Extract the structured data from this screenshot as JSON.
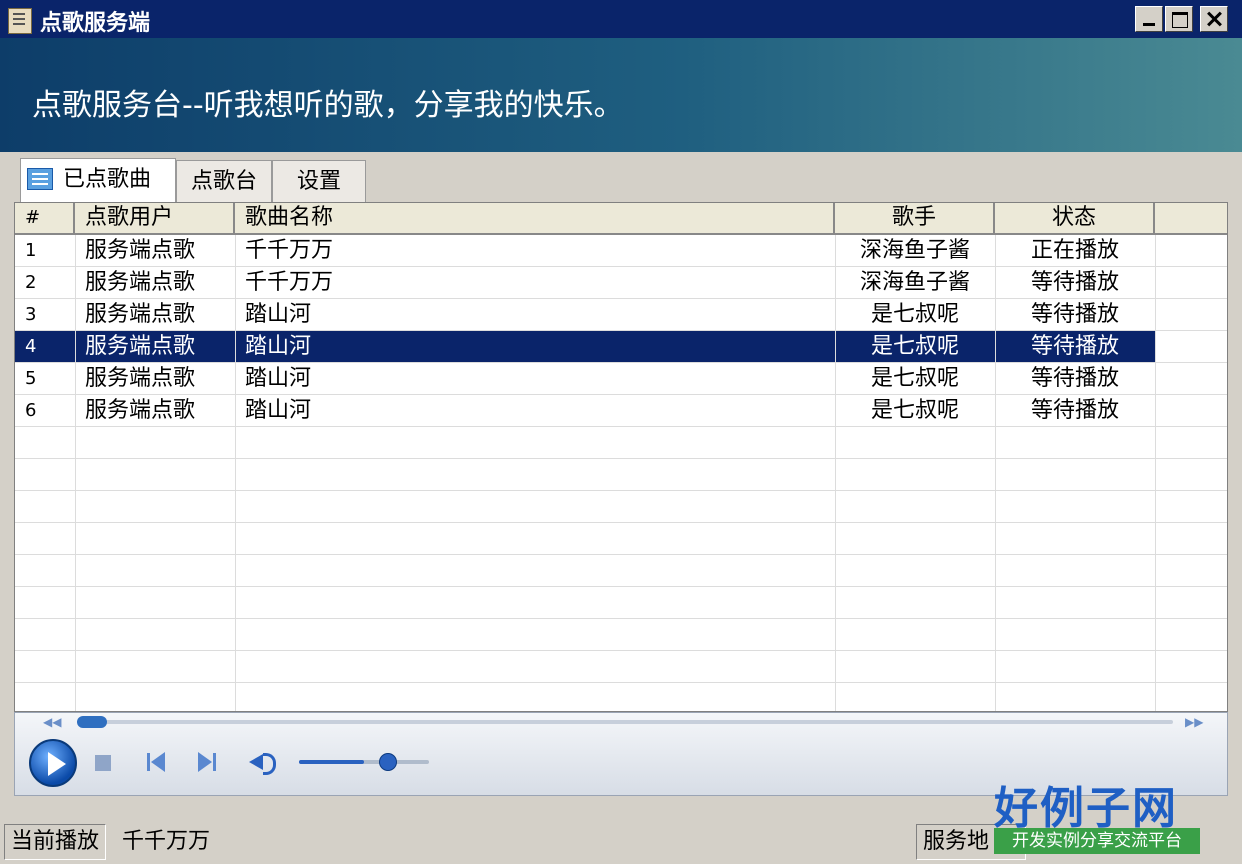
{
  "window": {
    "title": "点歌服务端"
  },
  "banner": {
    "text": "点歌服务台--听我想听的歌，分享我的快乐。"
  },
  "tabs": [
    {
      "label": "已点歌曲",
      "active": true
    },
    {
      "label": "点歌台",
      "active": false
    },
    {
      "label": "设置",
      "active": false
    }
  ],
  "table": {
    "columns": [
      "#",
      "点歌用户",
      "歌曲名称",
      "歌手",
      "状态"
    ],
    "rows": [
      {
        "num": "1",
        "user": "服务端点歌",
        "song": "千千万万",
        "artist": "深海鱼子酱",
        "status": "正在播放",
        "selected": false
      },
      {
        "num": "2",
        "user": "服务端点歌",
        "song": "千千万万",
        "artist": "深海鱼子酱",
        "status": "等待播放",
        "selected": false
      },
      {
        "num": "3",
        "user": "服务端点歌",
        "song": "踏山河",
        "artist": "是七叔呢",
        "status": "等待播放",
        "selected": false
      },
      {
        "num": "4",
        "user": "服务端点歌",
        "song": "踏山河",
        "artist": "是七叔呢",
        "status": "等待播放",
        "selected": true
      },
      {
        "num": "5",
        "user": "服务端点歌",
        "song": "踏山河",
        "artist": "是七叔呢",
        "status": "等待播放",
        "selected": false
      },
      {
        "num": "6",
        "user": "服务端点歌",
        "song": "踏山河",
        "artist": "是七叔呢",
        "status": "等待播放",
        "selected": false
      }
    ]
  },
  "player": {
    "seek_fraction": 0.0,
    "volume_fraction": 0.5
  },
  "statusbar": {
    "now_playing_label": "当前播放",
    "now_playing_value": "千千万万",
    "server_label": "服务地"
  },
  "watermark": {
    "logo_main": "好例子网",
    "logo_sub": "开发实例分享交流平台"
  },
  "colors": {
    "titlebar": "#0a246a",
    "selected_row": "#0a246a",
    "banner_start": "#0d3d69",
    "banner_end": "#4a8a93"
  }
}
